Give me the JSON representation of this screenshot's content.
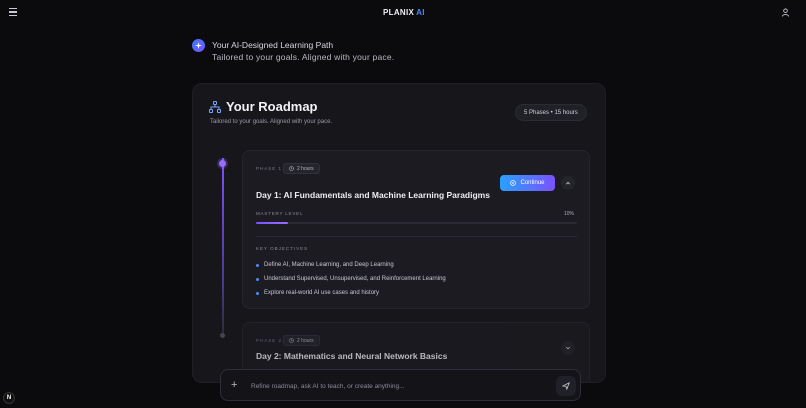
{
  "app": {
    "logo_text": "PLANIX",
    "logo_ai": "AI",
    "accent_color": "#4a8cff",
    "purple_color": "#7b52ff"
  },
  "intro": {
    "title": "Your AI-Designed Learning Path",
    "subtitle": "Tailored to your goals. Aligned with your pace."
  },
  "roadmap": {
    "title": "Your Roadmap",
    "subtitle": "Tailored to your goals. Aligned with your pace.",
    "meta": "5 Phases • 15 hours",
    "phases": [
      {
        "phase_label": "PHASE 1",
        "hours": "2 hours",
        "title": "Day 1: AI Fundamentals and Machine Learning Paradigms",
        "continue_label": "Continue",
        "mastery_label": "MASTERY LEVEL",
        "mastery_value": "10%",
        "mastery_fraction": 0.1,
        "objectives_heading": "KEY OBJECTIVES",
        "objectives": [
          "Define AI, Machine Learning, and Deep Learning",
          "Understand Supervised, Unsupervised, and Reinforcement Learning",
          "Explore real-world AI use cases and history"
        ]
      },
      {
        "phase_label": "PHASE 2",
        "hours": "2 hours",
        "title": "Day 2: Mathematics and Neural Network Basics"
      }
    ]
  },
  "prompt": {
    "placeholder": "Refine roadmap, ask AI to teach, or create anything..."
  },
  "corner_badge": "N",
  "icons": {
    "menu": "hamburger-menu-icon",
    "user": "user-icon",
    "intro": "sparkle-icon",
    "roadmap": "network-icon",
    "clock": "clock-icon",
    "play": "play-circle-icon",
    "chevron_up": "chevron-up-icon",
    "chevron_down": "chevron-down-icon",
    "plus": "plus-icon",
    "send": "send-icon"
  }
}
